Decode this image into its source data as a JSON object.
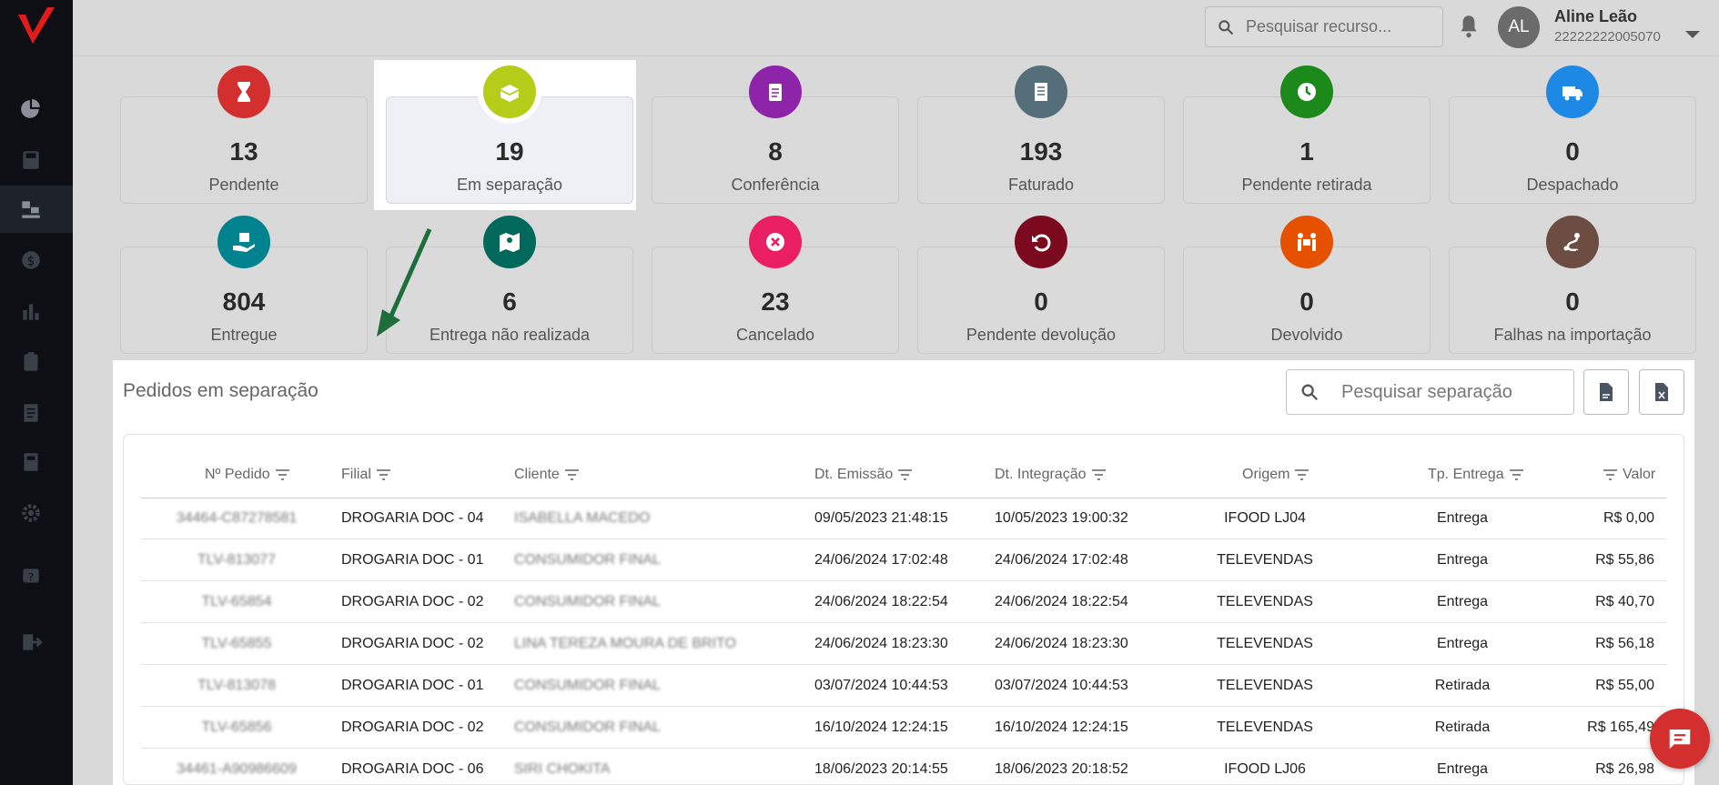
{
  "header": {
    "search_placeholder": "Pesquisar recurso...",
    "user_name": "Aline Leão",
    "user_id": "22222222005070",
    "avatar_initials": "AL"
  },
  "status_cards": [
    {
      "label": "Pendente",
      "count": "13",
      "color": "#d32f2f",
      "icon": "hourglass-icon"
    },
    {
      "label": "Em separação",
      "count": "19",
      "color": "#b5cc18",
      "icon": "open-box-icon"
    },
    {
      "label": "Conferência",
      "count": "8",
      "color": "#8e24aa",
      "icon": "clipboard-icon"
    },
    {
      "label": "Faturado",
      "count": "193",
      "color": "#546e7a",
      "icon": "receipt-icon"
    },
    {
      "label": "Pendente retirada",
      "count": "1",
      "color": "#1b8a1b",
      "icon": "clock-icon"
    },
    {
      "label": "Despachado",
      "count": "0",
      "color": "#1e88e5",
      "icon": "truck-icon"
    },
    {
      "label": "Entregue",
      "count": "804",
      "color": "#00838f",
      "icon": "hand-box-icon"
    },
    {
      "label": "Entrega não realizada",
      "count": "6",
      "color": "#00695c",
      "icon": "map-pin-icon"
    },
    {
      "label": "Cancelado",
      "count": "23",
      "color": "#e91e63",
      "icon": "cancel-icon"
    },
    {
      "label": "Pendente devolução",
      "count": "0",
      "color": "#7b0a1f",
      "icon": "undo-icon"
    },
    {
      "label": "Devolvido",
      "count": "0",
      "color": "#e65100",
      "icon": "people-box-icon"
    },
    {
      "label": "Falhas na importação",
      "count": "0",
      "color": "#6d4c41",
      "icon": "route-icon"
    }
  ],
  "panel": {
    "title": "Pedidos em separação",
    "search_placeholder": "Pesquisar separação"
  },
  "table": {
    "columns": [
      "Nº Pedido",
      "Filial",
      "Cliente",
      "Dt. Emissão",
      "Dt. Integração",
      "Origem",
      "Tp. Entrega",
      "Valor"
    ],
    "rows": [
      [
        "34464-C87278581",
        "DROGARIA DOC - 04",
        "ISABELLA MACEDO",
        "09/05/2023 21:48:15",
        "10/05/2023 19:00:32",
        "IFOOD LJ04",
        "Entrega",
        "R$ 0,00"
      ],
      [
        "TLV-813077",
        "DROGARIA DOC - 01",
        "CONSUMIDOR FINAL",
        "24/06/2024 17:02:48",
        "24/06/2024 17:02:48",
        "TELEVENDAS",
        "Entrega",
        "R$ 55,86"
      ],
      [
        "TLV-65854",
        "DROGARIA DOC - 02",
        "CONSUMIDOR FINAL",
        "24/06/2024 18:22:54",
        "24/06/2024 18:22:54",
        "TELEVENDAS",
        "Entrega",
        "R$ 40,70"
      ],
      [
        "TLV-65855",
        "DROGARIA DOC - 02",
        "LINA TEREZA MOURA DE BRITO",
        "24/06/2024 18:23:30",
        "24/06/2024 18:23:30",
        "TELEVENDAS",
        "Entrega",
        "R$ 56,18"
      ],
      [
        "TLV-813078",
        "DROGARIA DOC - 01",
        "CONSUMIDOR FINAL",
        "03/07/2024 10:44:53",
        "03/07/2024 10:44:53",
        "TELEVENDAS",
        "Retirada",
        "R$ 55,00"
      ],
      [
        "TLV-65856",
        "DROGARIA DOC - 02",
        "CONSUMIDOR FINAL",
        "16/10/2024 12:24:15",
        "16/10/2024 12:24:15",
        "TELEVENDAS",
        "Retirada",
        "R$ 165,49"
      ],
      [
        "34461-A90986609",
        "DROGARIA DOC - 06",
        "SIRI CHOKITA",
        "18/06/2023 20:14:55",
        "18/06/2023 20:18:52",
        "IFOOD LJ06",
        "Entrega",
        "R$ 26,98"
      ]
    ]
  },
  "sidebar": {
    "items": [
      "dashboard-icon",
      "save-icon",
      "delivery-icon",
      "money-icon",
      "chart-icon",
      "clipboard-icon",
      "receipt-icon",
      "book-icon",
      "gear-icon",
      "help-icon",
      "logout-icon"
    ]
  }
}
